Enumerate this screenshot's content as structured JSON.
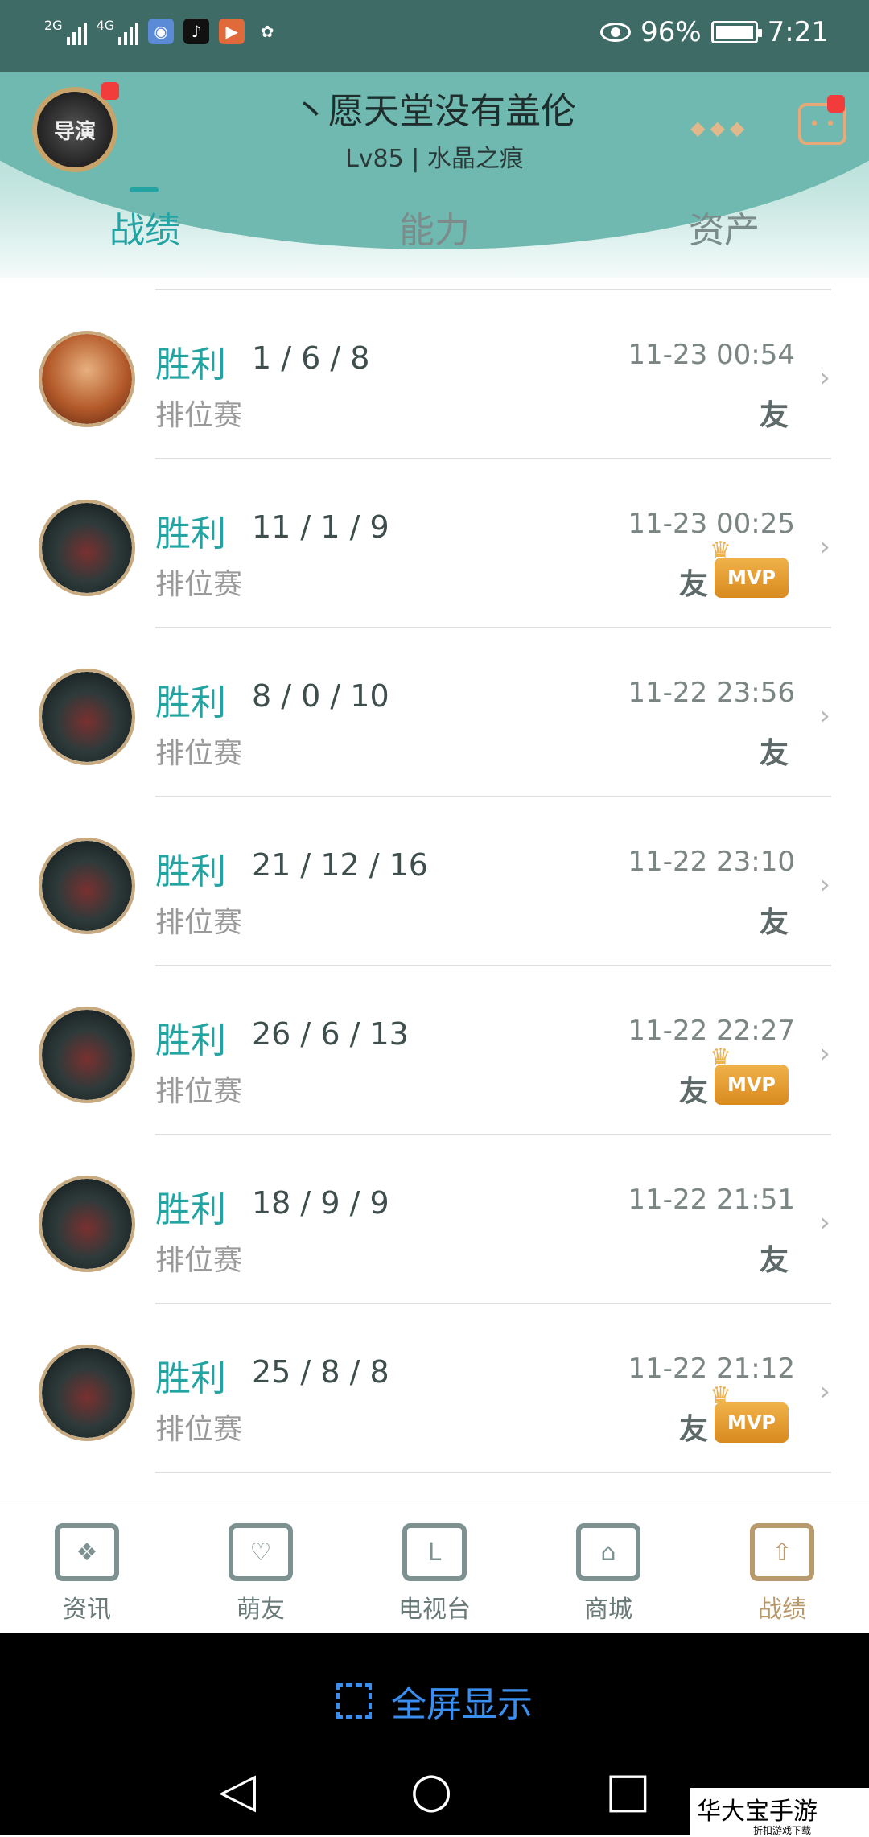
{
  "status_bar": {
    "network": [
      "2G",
      "4G"
    ],
    "battery": "96%",
    "time": "7:21"
  },
  "profile": {
    "name": "丶愿天堂没有盖伦",
    "level": "Lv85 | 水晶之痕",
    "avatar_text": "导演"
  },
  "tabs": [
    "战绩",
    "能力",
    "资产"
  ],
  "matches": [
    {
      "result": "胜利",
      "kda": "1 / 6 / 8",
      "mode": "排位赛",
      "time": "11-23 00:54",
      "friend": "友",
      "mvp": false,
      "hero": "f"
    },
    {
      "result": "胜利",
      "kda": "11 / 1 / 9",
      "mode": "排位赛",
      "time": "11-23 00:25",
      "friend": "友",
      "mvp": true,
      "hero": "m"
    },
    {
      "result": "胜利",
      "kda": "8 / 0 / 10",
      "mode": "排位赛",
      "time": "11-22 23:56",
      "friend": "友",
      "mvp": false,
      "hero": "m"
    },
    {
      "result": "胜利",
      "kda": "21 / 12 / 16",
      "mode": "排位赛",
      "time": "11-22 23:10",
      "friend": "友",
      "mvp": false,
      "hero": "m"
    },
    {
      "result": "胜利",
      "kda": "26 / 6 / 13",
      "mode": "排位赛",
      "time": "11-22 22:27",
      "friend": "友",
      "mvp": true,
      "hero": "m"
    },
    {
      "result": "胜利",
      "kda": "18 / 9 / 9",
      "mode": "排位赛",
      "time": "11-22 21:51",
      "friend": "友",
      "mvp": false,
      "hero": "m"
    },
    {
      "result": "胜利",
      "kda": "25 / 8 / 8",
      "mode": "排位赛",
      "time": "11-22 21:12",
      "friend": "友",
      "mvp": true,
      "hero": "m"
    }
  ],
  "mvp_label": "MVP",
  "bottom_nav": [
    "资讯",
    "萌友",
    "电视台",
    "商城",
    "战绩"
  ],
  "fullscreen_label": "全屏显示",
  "watermark": {
    "title": "华大宝手游",
    "subtitle": "折扣游戏下载"
  },
  "colors": {
    "accent": "#24a3a3",
    "status_bar": "#3f6b66",
    "active_nav": "#b99a6d",
    "mvp": "#e29a2e"
  }
}
